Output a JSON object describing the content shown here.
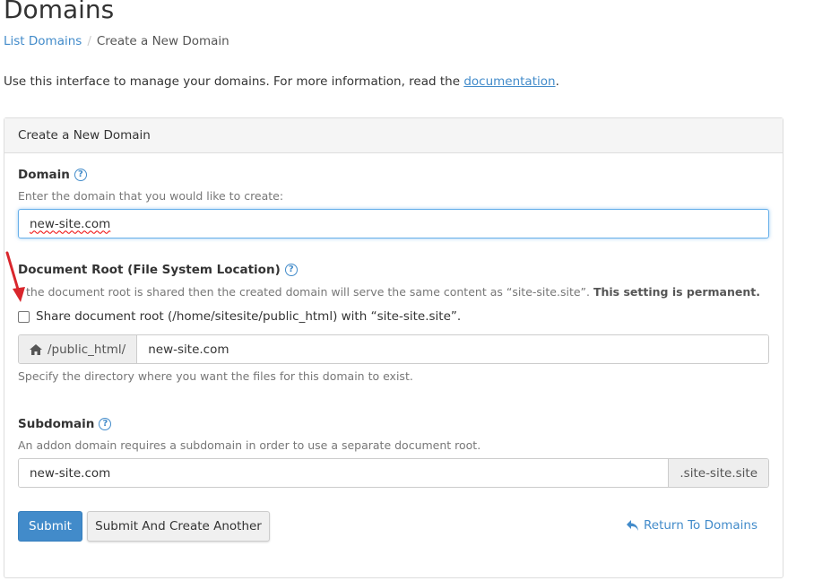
{
  "page": {
    "title": "Domains"
  },
  "breadcrumb": {
    "parent": "List Domains",
    "separator": "/",
    "current": "Create a New Domain"
  },
  "intro": {
    "text": "Use this interface to manage your domains. For more information, read the ",
    "link": "documentation",
    "suffix": "."
  },
  "panel": {
    "heading": "Create a New Domain"
  },
  "domain": {
    "label": "Domain",
    "hint": "Enter the domain that you would like to create:",
    "value": "new-site.com"
  },
  "docroot": {
    "label": "Document Root (File System Location)",
    "hint_partial": "the document root is shared then the created domain will serve the same content as “site-site.site”. ",
    "hint_bold": "This setting is permanent.",
    "checkbox_label": "Share document root (/home/sitesite/public_html) with “site-site.site”.",
    "checkbox_checked": false,
    "prefix": "/public_html/",
    "value": "new-site.com",
    "help": "Specify the directory where you want the files for this domain to exist."
  },
  "subdomain": {
    "label": "Subdomain",
    "hint": "An addon domain requires a subdomain in order to use a separate document root.",
    "value": "new-site.com",
    "suffix": ".site-site.site"
  },
  "actions": {
    "submit": "Submit",
    "submit_another": "Submit And Create Another",
    "return": "Return To Domains"
  },
  "colors": {
    "accent": "#428bca",
    "annotation_arrow": "#d9262c"
  }
}
